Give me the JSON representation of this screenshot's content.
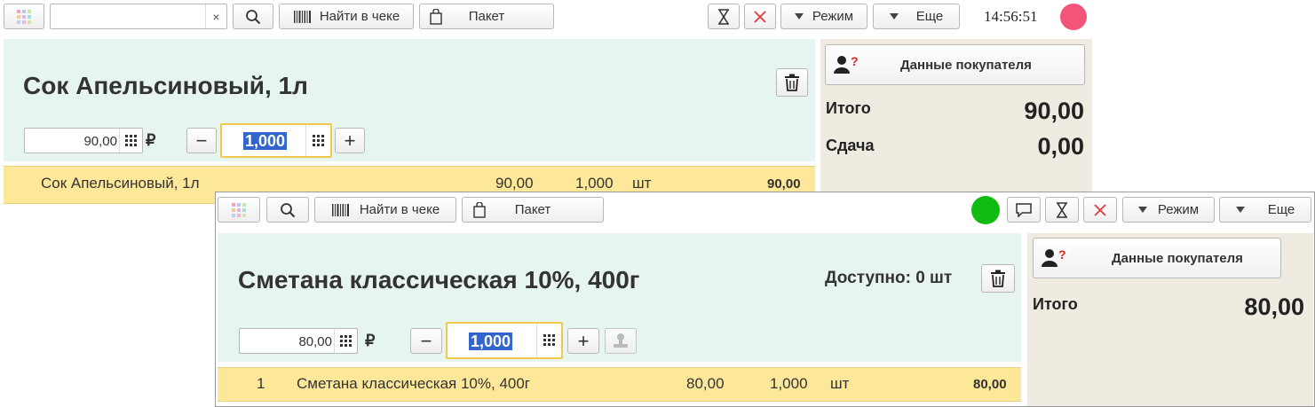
{
  "window_a": {
    "toolbar": {
      "find_label": "Найти в чеке",
      "package_label": "Пакет",
      "mode_label": "Режим",
      "more_label": "Еще",
      "clear_symbol": "×",
      "time": "14:56:51",
      "status_color": "#f2547a"
    },
    "product": {
      "title": "Сок Апельсиновый, 1л",
      "price": "90,00",
      "currency": "₽",
      "quantity": "1,000"
    },
    "receipt_rows": [
      {
        "name": "Сок Апельсиновый, 1л",
        "price": "90,00",
        "qty": "1,000",
        "unit": "шт",
        "sum": "90,00"
      }
    ],
    "side": {
      "buyer_label": "Данные покупателя",
      "total_label": "Итого",
      "total_value": "90,00",
      "change_label": "Сдача",
      "change_value": "0,00"
    }
  },
  "window_b": {
    "toolbar": {
      "find_label": "Найти в чеке",
      "package_label": "Пакет",
      "mode_label": "Режим",
      "more_label": "Еще",
      "status_color": "#11bb11"
    },
    "product": {
      "title": "Сметана классическая 10%, 400г",
      "available": "Доступно: 0 шт",
      "price": "80,00",
      "currency": "₽",
      "quantity": "1,000"
    },
    "receipt_rows": [
      {
        "num": "1",
        "name": "Сметана классическая 10%, 400г",
        "price": "80,00",
        "qty": "1,000",
        "unit": "шт",
        "sum": "80,00"
      }
    ],
    "side": {
      "buyer_label": "Данные покупателя",
      "total_label": "Итого",
      "total_value": "80,00"
    }
  },
  "colors": {
    "product_bg": "#e6f5ef",
    "row_highlight": "#fde798",
    "side_bg": "#f0ebe0",
    "qty_border": "#f0c94a"
  }
}
